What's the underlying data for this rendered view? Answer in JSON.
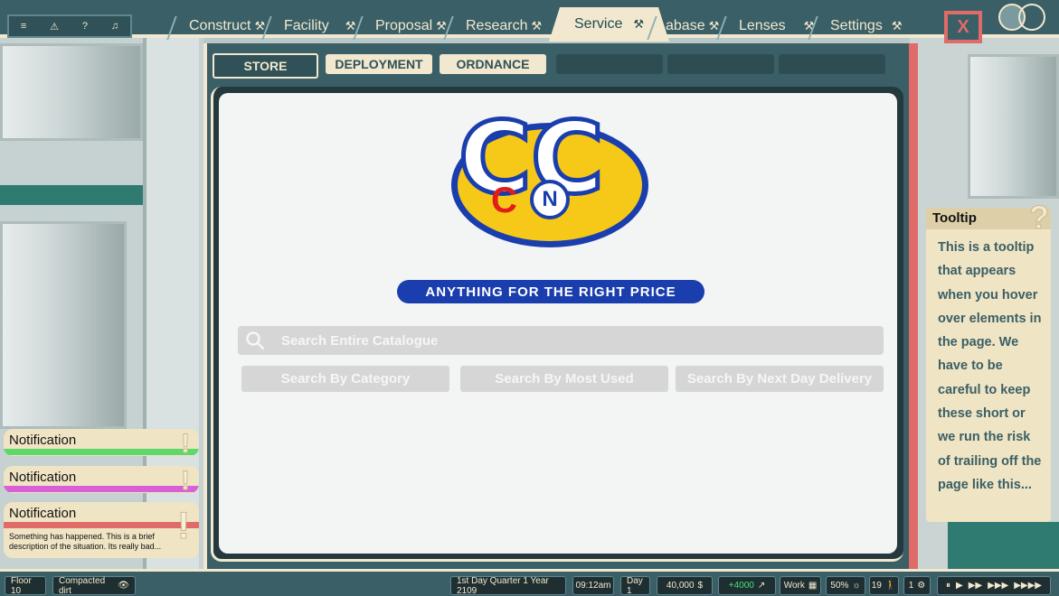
{
  "topbar": {
    "quick_icons": [
      "menu-icon",
      "warning-icon",
      "help-icon",
      "bell-icon"
    ],
    "tabs": [
      {
        "label": "Construct",
        "active": false
      },
      {
        "label": "Facility",
        "active": false
      },
      {
        "label": "Proposal",
        "active": false
      },
      {
        "label": "Research",
        "active": false
      },
      {
        "label": "Service",
        "active": true
      },
      {
        "label": "abase",
        "active": false
      },
      {
        "label": "Lenses",
        "active": false
      },
      {
        "label": "Settings",
        "active": false
      }
    ],
    "tool_glyph": "⚒",
    "close_label": "X"
  },
  "subtabs": [
    "STORE",
    "DEPLOYMENT",
    "ORDNANCE"
  ],
  "store": {
    "logo_letters": {
      "c": "C",
      "n": "N"
    },
    "slogan": "ANYTHING FOR THE RIGHT PRICE",
    "search_placeholder": "Search Entire Catalogue",
    "buttons": [
      "Search By Category",
      "Search By Most Used",
      "Search By Next Day Delivery"
    ]
  },
  "tooltip": {
    "title": "Tooltip",
    "icon": "?",
    "body": "This is a tooltip that appears when you hover over elements in the page. We have to be careful to keep these short or we run the risk of trailing off the page like this..."
  },
  "notifications": [
    {
      "title": "Notification",
      "color": "#5fd86a",
      "icon": "!"
    },
    {
      "title": "Notification",
      "color": "#d95fd6",
      "icon": "!"
    },
    {
      "title": "Notification",
      "color": "#e06b68",
      "icon": "!",
      "description": "Something has happened.  This is a brief description of the situation. Its really bad..."
    }
  ],
  "bottombar": {
    "floor": "Floor 10",
    "terrain": "Compacted dirt",
    "date": "1st Day Quarter 1 Year 2109",
    "time": "09:12am",
    "day": "Day 1",
    "money": "40,000",
    "money_symbol": "$",
    "income": "+4000",
    "mode": "Work",
    "percent": "50%",
    "staff": "19",
    "alerts": "1",
    "speed_controls": [
      "⏸",
      "▶",
      "▶▶",
      "▶▶▶",
      "▶▶▶▶"
    ]
  }
}
